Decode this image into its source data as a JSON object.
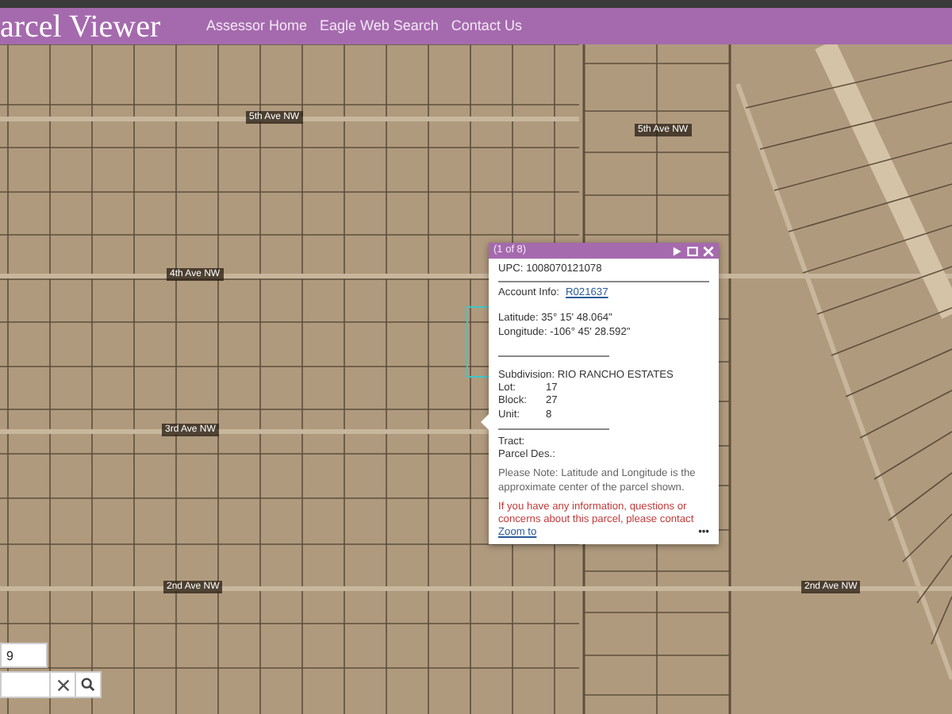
{
  "header": {
    "title": "arcel Viewer",
    "nav": [
      {
        "label": "Assessor Home"
      },
      {
        "label": "Eagle Web Search"
      },
      {
        "label": "Contact Us"
      }
    ]
  },
  "map": {
    "street_labels": [
      {
        "text": "5th Ave NW"
      },
      {
        "text": "5th Ave NW"
      },
      {
        "text": "4th Ave NW"
      },
      {
        "text": "3rd Ave NW"
      },
      {
        "text": "2nd Ave NW"
      },
      {
        "text": "2nd Ave NW"
      }
    ]
  },
  "popup": {
    "counter": "(1 of 8)",
    "upc": "UPC: 1008070121078",
    "account_label": "Account Info:",
    "account_link": "R021637",
    "latitude": "Latitude: 35° 15' 48.064\"",
    "longitude": "Longitude: -106° 45' 28.592\"",
    "subdivision": "Subdivision: RIO RANCHO ESTATES",
    "fields": [
      {
        "label": "Lot:",
        "value": "17"
      },
      {
        "label": "Block:",
        "value": "27"
      },
      {
        "label": "Unit:",
        "value": "8"
      }
    ],
    "tract": "Tract:",
    "parcel_des": "Parcel Des.:",
    "note": "Please Note: Latitude and Longitude is the approximate center of the parcel shown.",
    "contact": "If you have any information, questions or concerns about this parcel, please contact",
    "zoom_link": "Zoom to",
    "more": "•••"
  },
  "search": {
    "layer_value": "9"
  }
}
